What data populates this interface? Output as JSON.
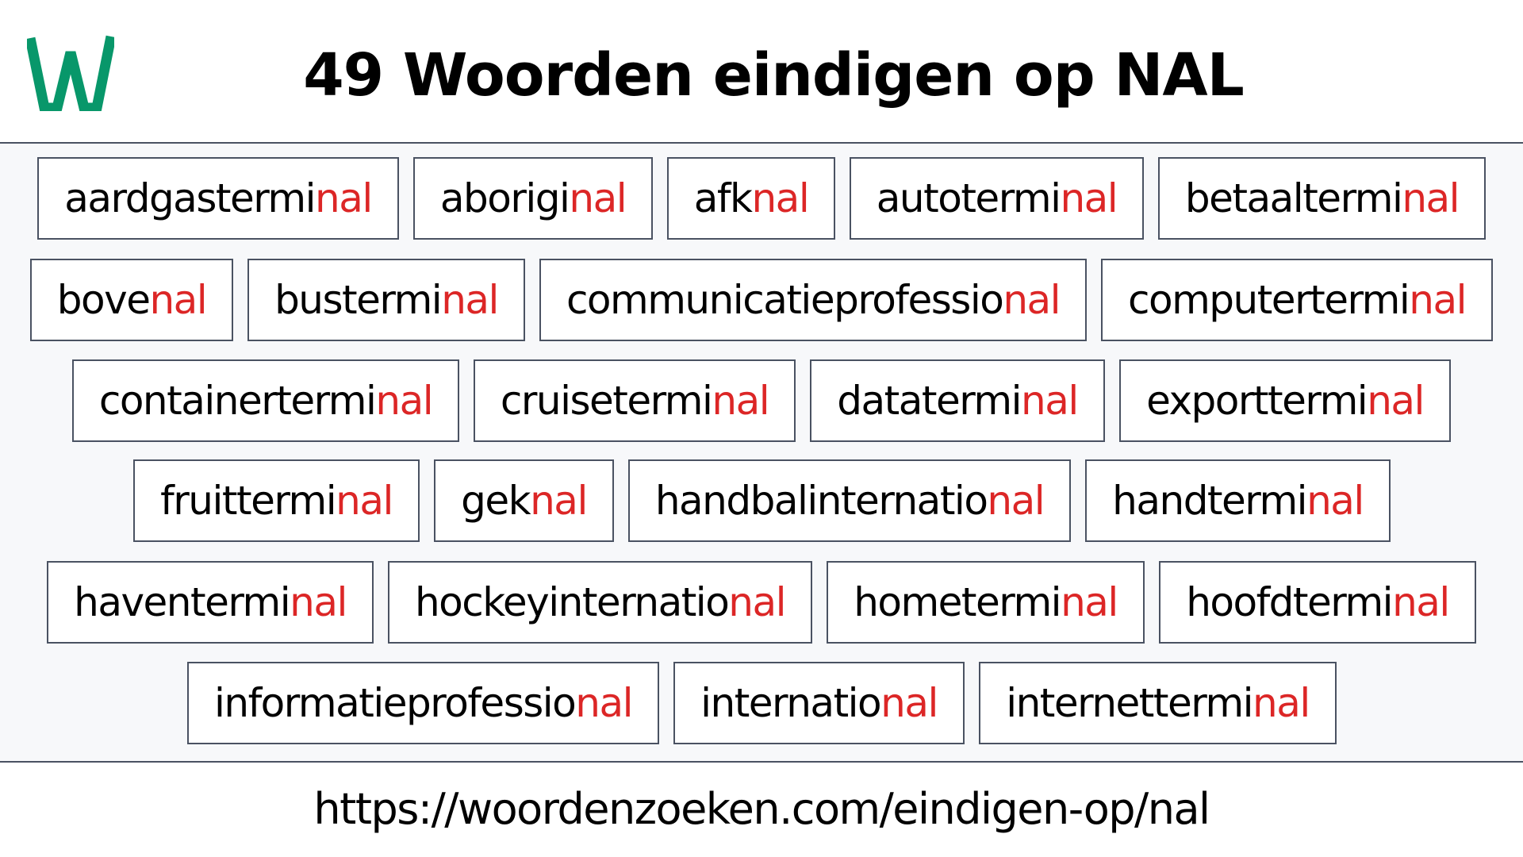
{
  "logo": {
    "letter": "W",
    "color": "#08976a"
  },
  "header": {
    "title": "49 Woorden eindigen op NAL"
  },
  "suffix": "nal",
  "accent_color": "#dc2626",
  "words": [
    {
      "prefix": "aardgastermi",
      "suffix": "nal",
      "row": 0
    },
    {
      "prefix": "aborigi",
      "suffix": "nal",
      "row": 0
    },
    {
      "prefix": "afk",
      "suffix": "nal",
      "row": 0
    },
    {
      "prefix": "autotermi",
      "suffix": "nal",
      "row": 0
    },
    {
      "prefix": "betaaltermi",
      "suffix": "nal",
      "row": 0
    },
    {
      "prefix": "bove",
      "suffix": "nal",
      "row": 1
    },
    {
      "prefix": "bustermi",
      "suffix": "nal",
      "row": 1
    },
    {
      "prefix": "communicatieprofessio",
      "suffix": "nal",
      "row": 1
    },
    {
      "prefix": "computertermi",
      "suffix": "nal",
      "row": 1
    },
    {
      "prefix": "containertermi",
      "suffix": "nal",
      "row": 2
    },
    {
      "prefix": "cruisetermi",
      "suffix": "nal",
      "row": 2
    },
    {
      "prefix": "datatermi",
      "suffix": "nal",
      "row": 2
    },
    {
      "prefix": "exporttermi",
      "suffix": "nal",
      "row": 2
    },
    {
      "prefix": "fruittermi",
      "suffix": "nal",
      "row": 3
    },
    {
      "prefix": "gek",
      "suffix": "nal",
      "row": 3
    },
    {
      "prefix": "handbalinternatio",
      "suffix": "nal",
      "row": 3
    },
    {
      "prefix": "handtermi",
      "suffix": "nal",
      "row": 3
    },
    {
      "prefix": "haventermi",
      "suffix": "nal",
      "row": 4
    },
    {
      "prefix": "hockeyinternatio",
      "suffix": "nal",
      "row": 4
    },
    {
      "prefix": "hometermi",
      "suffix": "nal",
      "row": 4
    },
    {
      "prefix": "hoofdtermi",
      "suffix": "nal",
      "row": 4
    },
    {
      "prefix": "informatieprofessio",
      "suffix": "nal",
      "row": 5
    },
    {
      "prefix": "internatio",
      "suffix": "nal",
      "row": 5
    },
    {
      "prefix": "internettermi",
      "suffix": "nal",
      "row": 5
    }
  ],
  "footer": {
    "url": "https://woordenzoeken.com/eindigen-op/nal"
  }
}
